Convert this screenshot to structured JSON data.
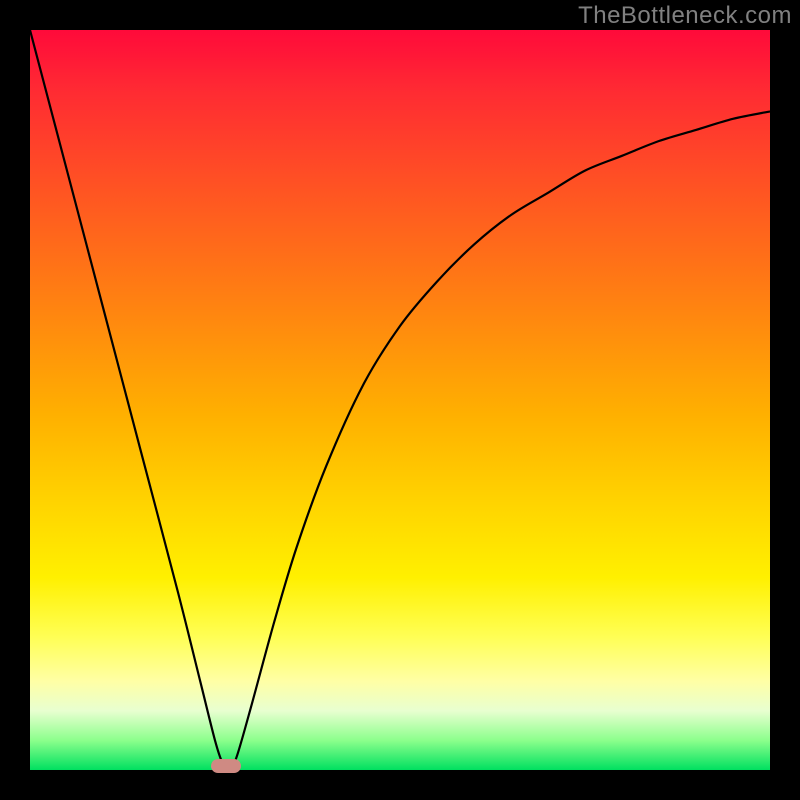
{
  "watermark": "TheBottleneck.com",
  "chart_data": {
    "type": "line",
    "title": "",
    "xlabel": "",
    "ylabel": "",
    "xlim": [
      0,
      100
    ],
    "ylim": [
      0,
      100
    ],
    "grid": false,
    "legend": false,
    "series": [
      {
        "name": "curve",
        "x": [
          0,
          5,
          10,
          15,
          20,
          23,
          25,
          26,
          27,
          28,
          30,
          33,
          36,
          40,
          45,
          50,
          55,
          60,
          65,
          70,
          75,
          80,
          85,
          90,
          95,
          100
        ],
        "values": [
          100,
          81,
          62,
          43,
          24,
          12,
          4,
          1,
          0,
          2,
          9,
          20,
          30,
          41,
          52,
          60,
          66,
          71,
          75,
          78,
          81,
          83,
          85,
          86.5,
          88,
          89
        ]
      }
    ],
    "marker": {
      "x": 26.5,
      "y": 0.5
    },
    "gradient_stops": [
      {
        "pct": 0,
        "color": "#ff0a3a"
      },
      {
        "pct": 8,
        "color": "#ff2a33"
      },
      {
        "pct": 22,
        "color": "#ff5522"
      },
      {
        "pct": 38,
        "color": "#ff8510"
      },
      {
        "pct": 52,
        "color": "#ffb000"
      },
      {
        "pct": 64,
        "color": "#ffd400"
      },
      {
        "pct": 74,
        "color": "#fff000"
      },
      {
        "pct": 82,
        "color": "#ffff55"
      },
      {
        "pct": 88,
        "color": "#ffffa5"
      },
      {
        "pct": 92,
        "color": "#e8ffd0"
      },
      {
        "pct": 96,
        "color": "#8cff8c"
      },
      {
        "pct": 100,
        "color": "#00e060"
      }
    ]
  }
}
